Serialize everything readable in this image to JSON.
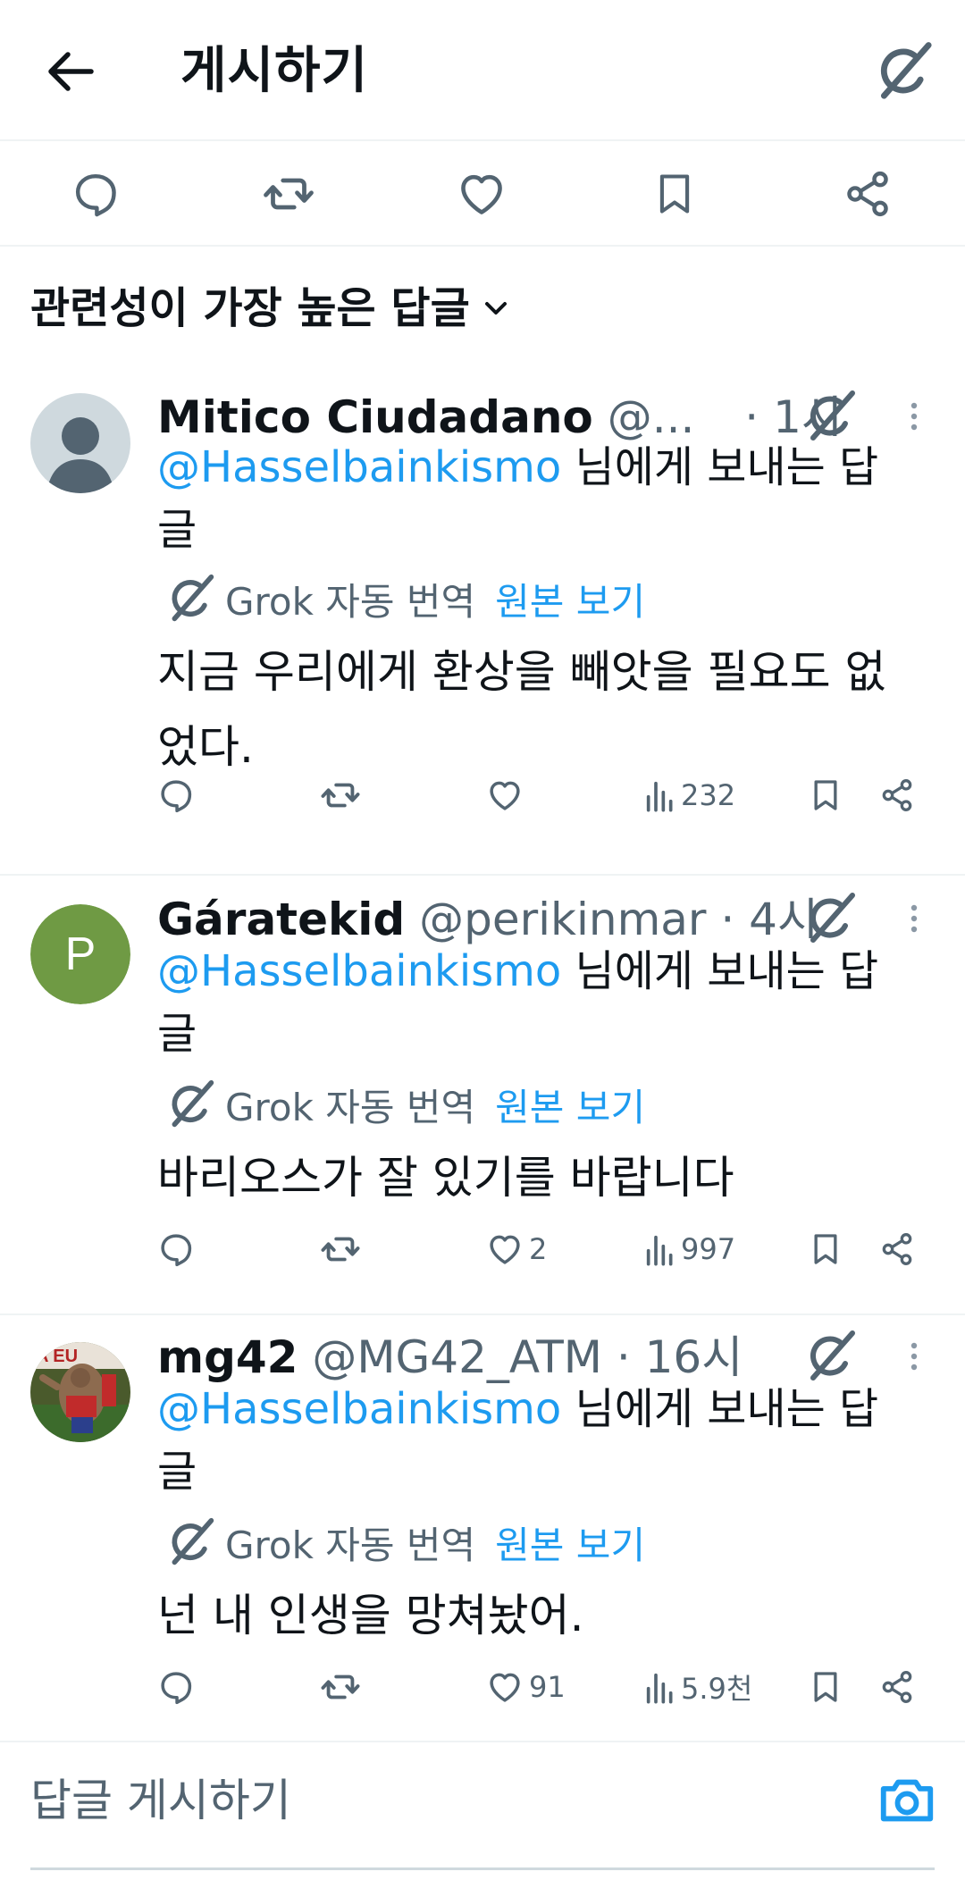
{
  "header": {
    "title": "게시하기"
  },
  "sort": {
    "label": "관련성이 가장 높은 답글"
  },
  "replies": [
    {
      "name": "Mitico Ciudadano",
      "handle": "@...",
      "time": "· 1시",
      "replying_mention": "@Hasselbainkismo",
      "replying_suffix": " 님에게 보내는 답글",
      "translate_label": "Grok 자동 번역",
      "translate_link": "원본 보기",
      "text": "지금 우리에게 환상을 빼앗을 필요도 없었다.",
      "likes": "",
      "views": "232",
      "avatar": {
        "type": "default"
      }
    },
    {
      "name": "Gáratekid",
      "handle": "@perikinmar",
      "time": "· 4시",
      "replying_mention": "@Hasselbainkismo",
      "replying_suffix": " 님에게 보내는 답글",
      "translate_label": "Grok 자동 번역",
      "translate_link": "원본 보기",
      "text": "바리오스가 잘 있기를 바랍니다",
      "likes": "2",
      "views": "997",
      "avatar": {
        "type": "letter",
        "letter": "P",
        "color": "#6f9a44"
      }
    },
    {
      "name": "mg42",
      "handle": "@MG42_ATM",
      "time": "· 16시",
      "replying_mention": "@Hasselbainkismo",
      "replying_suffix": " 님에게 보내는 답글",
      "translate_label": "Grok 자동 번역",
      "translate_link": "원본 보기",
      "text": "넌 내 인생을 망쳐놨어.",
      "likes": "91",
      "views": "5.9천",
      "avatar": {
        "type": "photo"
      }
    }
  ],
  "compose": {
    "placeholder": "답글 게시하기"
  },
  "colors": {
    "accent": "#1d9bf0",
    "secondary": "#536471",
    "text": "#0f1419",
    "divider": "#eff3f4"
  },
  "icons": [
    "back-arrow-icon",
    "grok-icon",
    "reply-icon",
    "retweet-icon",
    "like-icon",
    "bookmark-icon",
    "share-icon",
    "views-icon",
    "more-icon",
    "chevron-down-icon",
    "camera-icon"
  ]
}
